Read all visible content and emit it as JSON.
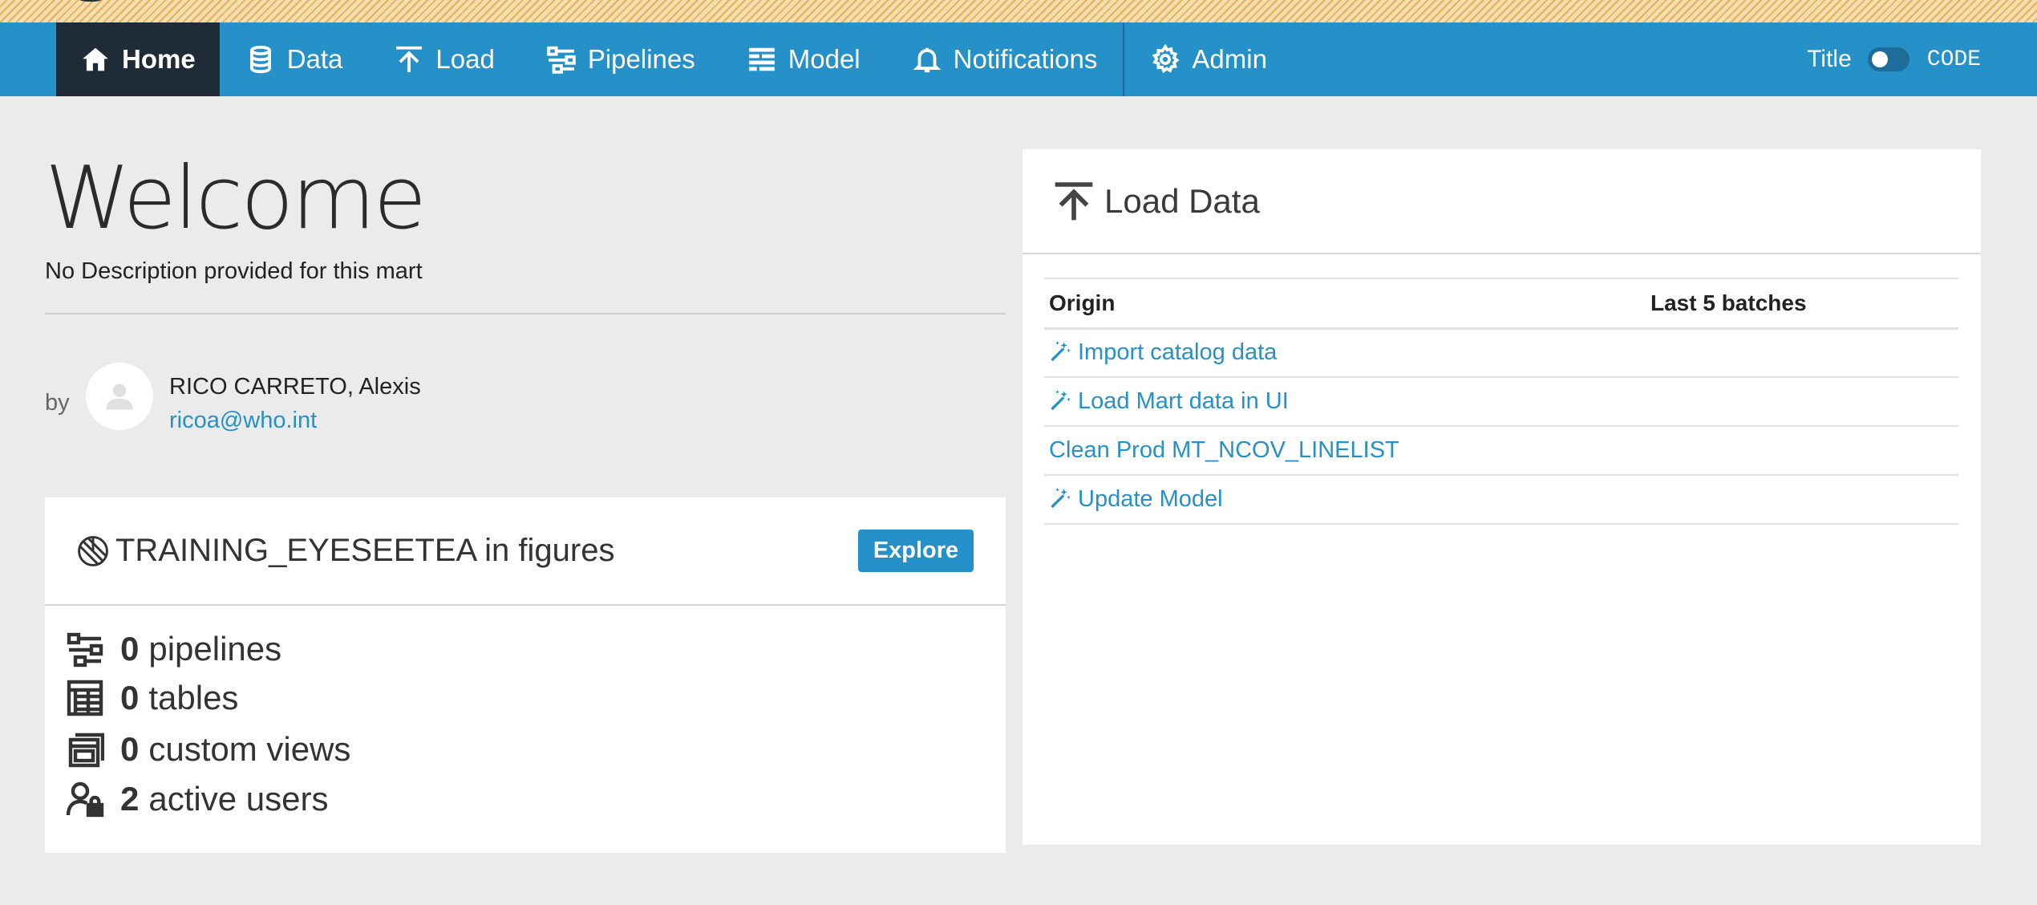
{
  "nav": {
    "items": [
      {
        "label": "Home",
        "icon": "home-icon",
        "active": true
      },
      {
        "label": "Data",
        "icon": "database-icon"
      },
      {
        "label": "Load",
        "icon": "upload-icon"
      },
      {
        "label": "Pipelines",
        "icon": "pipelines-icon"
      },
      {
        "label": "Model",
        "icon": "model-icon"
      },
      {
        "label": "Notifications",
        "icon": "bell-icon"
      },
      {
        "label": "Admin",
        "icon": "gear-icon"
      }
    ],
    "toggle_left": "Title",
    "toggle_right": "CODE"
  },
  "welcome": {
    "title": "Welcome",
    "description": "No Description provided for this mart",
    "by_label": "by",
    "owner_name": "RICO CARRETO, Alexis",
    "owner_email": "ricoa@who.int"
  },
  "figures": {
    "title": "TRAINING_EYESEETEA in figures",
    "explore_label": "Explore",
    "stats": [
      {
        "value": "0",
        "label": "pipelines",
        "icon": "pipelines-icon"
      },
      {
        "value": "0",
        "label": "tables",
        "icon": "table-icon"
      },
      {
        "value": "0",
        "label": "custom views",
        "icon": "views-icon"
      },
      {
        "value": "2",
        "label": "active users",
        "icon": "user-lock-icon"
      }
    ]
  },
  "load": {
    "title": "Load Data",
    "columns": [
      "Origin",
      "Last 5 batches"
    ],
    "rows": [
      {
        "label": "Import catalog data",
        "icon": "magic-wand-icon"
      },
      {
        "label": "Load Mart data in UI",
        "icon": "magic-wand-icon"
      },
      {
        "label": "Clean Prod MT_NCOV_LINELIST",
        "icon": ""
      },
      {
        "label": "Update Model",
        "icon": "magic-wand-icon"
      }
    ]
  },
  "colors": {
    "primary": "#2690c8",
    "nav_active": "#1f2c38",
    "background": "#ebebeb"
  }
}
